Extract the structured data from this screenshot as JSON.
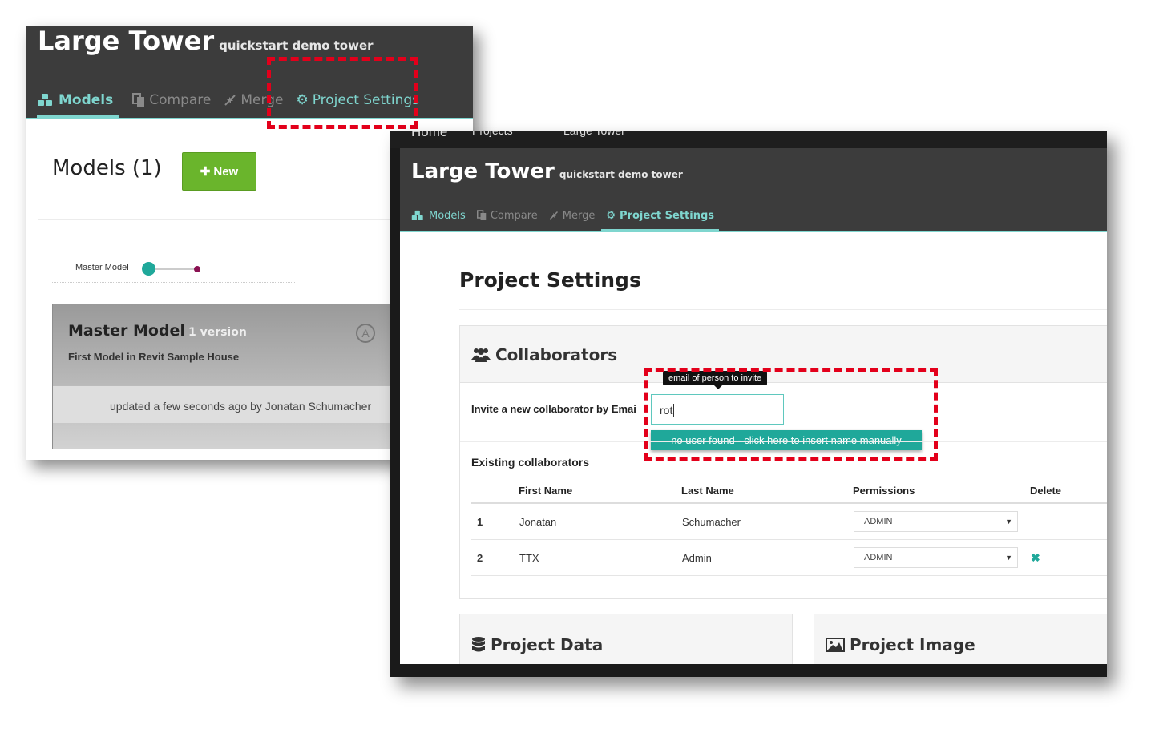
{
  "back_window": {
    "app_title": "Large Tower",
    "app_subtitle": "quickstart demo tower",
    "nav": {
      "models": "Models",
      "compare": "Compare",
      "merge": "Merge",
      "project_settings": "Project Settings"
    },
    "models_heading": "Models (1)",
    "new_button": "New",
    "timeline_label": "Master Model",
    "model_card": {
      "name": "Master Model",
      "version": "1 version",
      "description": "First Model in Revit Sample House",
      "updated": "updated a few seconds ago by Jonatan Schumacher"
    }
  },
  "front_window": {
    "breadcrumb": {
      "home": "Home",
      "projects": "Projects",
      "current": "Large Tower"
    },
    "app_title": "Large Tower",
    "app_subtitle": "quickstart demo tower",
    "nav": {
      "models": "Models",
      "compare": "Compare",
      "merge": "Merge",
      "project_settings": "Project Settings"
    },
    "page_title": "Project Settings",
    "collaborators": {
      "title": "Collaborators",
      "invite_label": "Invite a new collaborator by Emai",
      "invite_value": "rot",
      "tooltip": "email of person to invite",
      "suggestion": "no user found - click here to insert name manually",
      "existing_label": "Existing collaborators",
      "columns": [
        "",
        "First Name",
        "Last Name",
        "Permissions",
        "Delete"
      ],
      "rows": [
        {
          "index": "1",
          "first": "Jonatan",
          "last": "Schumacher",
          "permission": "ADMIN",
          "deletable": false
        },
        {
          "index": "2",
          "first": "TTX",
          "last": "Admin",
          "permission": "ADMIN",
          "deletable": true
        }
      ],
      "delete_symbol": "✖"
    },
    "project_data_title": "Project Data",
    "project_image_title": "Project Image"
  },
  "colors": {
    "accent": "#7fd6cf",
    "teal": "#1fa89a",
    "header": "#3c3c3c",
    "new_button": "#6ab52c",
    "highlight": "#e3001b"
  }
}
